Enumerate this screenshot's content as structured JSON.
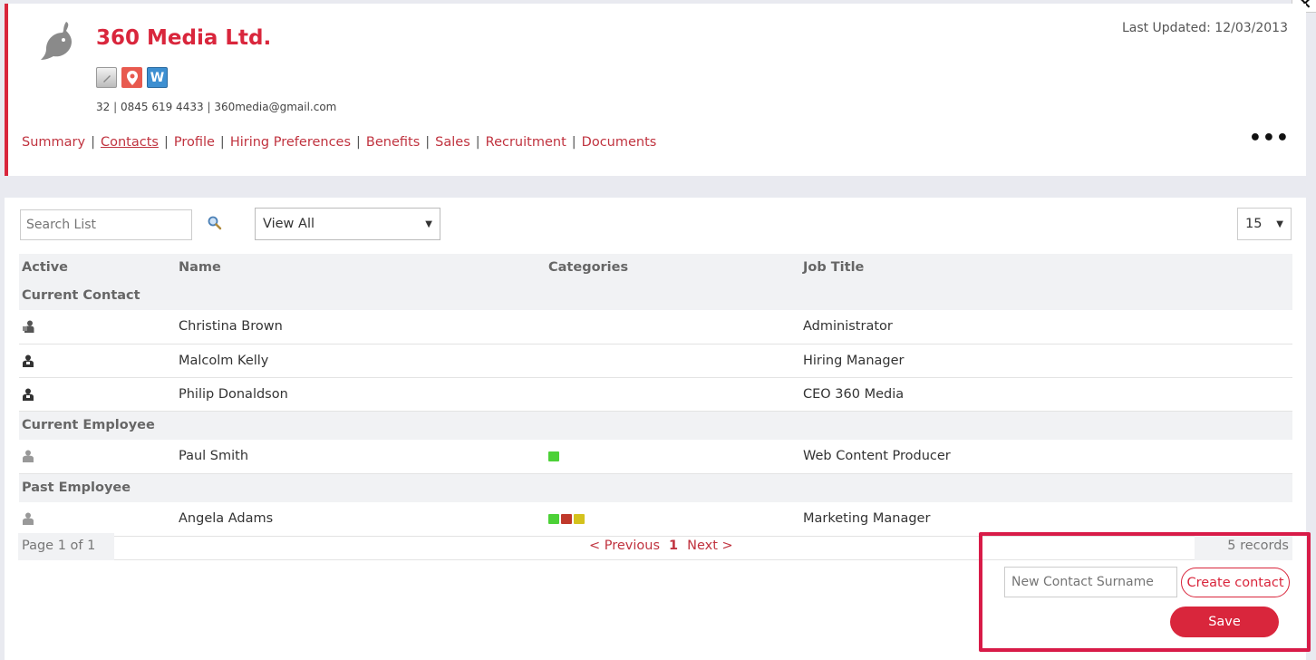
{
  "window": {
    "close_label": "×"
  },
  "company": {
    "name": "360 Media Ltd.",
    "last_updated": "Last Updated: 12/03/2013",
    "contact_number": "32",
    "phone": "0845 619 4433",
    "email": "360media@gmail.com",
    "social_icons": [
      "document-icon",
      "map-pin-icon",
      "w-icon"
    ],
    "w_label": "W"
  },
  "nav": {
    "tabs": [
      {
        "label": "Summary",
        "active": false
      },
      {
        "label": "Contacts",
        "active": true
      },
      {
        "label": "Profile",
        "active": false
      },
      {
        "label": "Hiring Preferences",
        "active": false
      },
      {
        "label": "Benefits",
        "active": false
      },
      {
        "label": "Sales",
        "active": false
      },
      {
        "label": "Recruitment",
        "active": false
      },
      {
        "label": "Documents",
        "active": false
      }
    ],
    "separator": "|",
    "more_label": "•••"
  },
  "toolbar": {
    "search_placeholder": "Search List",
    "view_filter": "View All",
    "page_size": "15"
  },
  "table": {
    "headers": {
      "active": "Active",
      "name": "Name",
      "categories": "Categories",
      "job_title": "Job Title"
    },
    "groups": [
      {
        "label": "Current Contact",
        "rows": [
          {
            "name": "Christina Brown",
            "job_title": "Administrator",
            "icon": "contact-person-icon",
            "categories": []
          },
          {
            "name": "Malcolm Kelly",
            "job_title": "Hiring Manager",
            "icon": "contact-person-icon",
            "categories": []
          },
          {
            "name": "Philip Donaldson",
            "job_title": "CEO 360 Media",
            "icon": "contact-person-icon",
            "categories": []
          }
        ]
      },
      {
        "label": "Current Employee",
        "rows": [
          {
            "name": "Paul Smith",
            "job_title": "Web Content Producer",
            "icon": "person-icon",
            "categories": [
              "#4cd137"
            ]
          }
        ]
      },
      {
        "label": "Past Employee",
        "rows": [
          {
            "name": "Angela Adams",
            "job_title": "Marketing Manager",
            "icon": "person-icon",
            "categories": [
              "#4cd137",
              "#c0392b",
              "#d4c21d"
            ]
          }
        ]
      }
    ]
  },
  "pager": {
    "page_info": "Page 1 of 1",
    "previous": "< Previous",
    "current": "1",
    "next": "Next >",
    "records": "5 records"
  },
  "new_contact": {
    "placeholder": "New Contact Surname",
    "create_label": "Create contact",
    "save_label": "Save"
  },
  "colors": {
    "accent": "#d9263c",
    "highlight": "#d81b48"
  }
}
